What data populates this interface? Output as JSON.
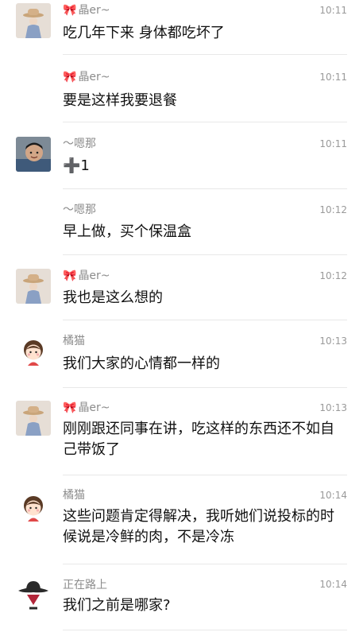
{
  "messages": [
    {
      "sender": "晶er~",
      "sender_prefix": "🎀",
      "time": "10:11",
      "text": "吃几年下来 身体都吃坏了",
      "avatar": "straw-hat-avatar"
    },
    {
      "sender": "晶er~",
      "sender_prefix": "🎀",
      "time": "10:11",
      "text": "要是这样我要退餐",
      "avatar": ""
    },
    {
      "sender": "～嗯那",
      "sender_prefix": "",
      "time": "10:11",
      "text": "➕1",
      "avatar": "photo-avatar"
    },
    {
      "sender": "～嗯那",
      "sender_prefix": "",
      "time": "10:12",
      "text": "早上做，买个保温盒",
      "avatar": ""
    },
    {
      "sender": "晶er~",
      "sender_prefix": "🎀",
      "time": "10:12",
      "text": "我也是这么想的",
      "avatar": "straw-hat-avatar"
    },
    {
      "sender": "橘猫",
      "sender_prefix": "",
      "time": "10:13",
      "text": "我们大家的心情都一样的",
      "avatar": "cartoon-girl-avatar"
    },
    {
      "sender": "晶er~",
      "sender_prefix": "🎀",
      "time": "10:13",
      "text": "刚刚跟还同事在讲，吃这样的东西还不如自己带饭了",
      "avatar": "straw-hat-avatar"
    },
    {
      "sender": "橘猫",
      "sender_prefix": "",
      "time": "10:14",
      "text": "这些问题肯定得解决，我听她们说投标的时候说是冷鲜的肉，不是冷冻",
      "avatar": "cartoon-girl-avatar"
    },
    {
      "sender": "正在路上",
      "sender_prefix": "",
      "time": "10:14",
      "text": "我们之前是哪家?",
      "avatar": "cowboy-avatar"
    }
  ]
}
